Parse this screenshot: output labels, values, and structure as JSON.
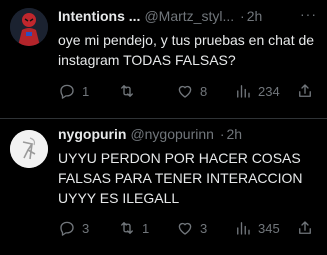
{
  "tweets": [
    {
      "name": "Intentions ...",
      "handle": "@Martz_styl...",
      "dot": "·",
      "time": "2h",
      "more": "···",
      "text": "oye mi pendejo, y tus pruebas en chat de instagram TODAS FALSAS?",
      "reply_count": "1",
      "retweet_count": "",
      "like_count": "8",
      "view_count": "234",
      "icons": {
        "reply": "reply-icon",
        "retweet": "retweet-icon",
        "like": "heart-icon",
        "views": "views-icon",
        "share": "share-icon"
      }
    },
    {
      "name": "nygopurin",
      "handle": "@nygopurinn",
      "dot": "·",
      "time": "2h",
      "text": "UYYU PERDON POR HACER COSAS FALSAS PARA TENER INTERACCION UYYY ES ILEGALL",
      "reply_count": "3",
      "retweet_count": "1",
      "like_count": "3",
      "view_count": "345",
      "icons": {
        "reply": "reply-icon",
        "retweet": "retweet-icon",
        "like": "heart-icon",
        "views": "views-icon",
        "share": "share-icon"
      }
    }
  ],
  "colors": {
    "background": "#000000",
    "text": "#e7e9ea",
    "muted": "#71767b",
    "divider": "#2f3336"
  }
}
